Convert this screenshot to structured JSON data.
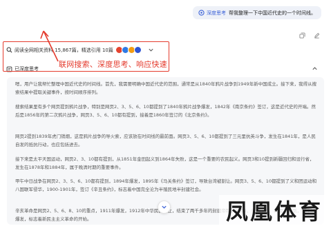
{
  "user_message": {
    "deep_think_label": "深度思考",
    "text": "帮我整理一下中国近代史的一个时间线。"
  },
  "search_summary": {
    "text": "阅读全网相关资料 15,867篇，精选引用 10篇",
    "source_colors": [
      "#e5432f",
      "#2f7ae5",
      "#f39c12",
      "#2f55d4"
    ]
  },
  "thought_summary": {
    "label": "已深度思考"
  },
  "annotation": {
    "text": "联网搜索、深度思考、响应快速",
    "color": "#e43a2c"
  },
  "thinking": {
    "paragraphs": [
      "嗯，用户让我帮忙整理中国近代史的时间线。首先，我需要明确中国近代史的范围，通常是从1840年鸦片战争到1949年新中国成立。接下来，我得从搜索结果中提取关键事件，按时间顺序排列。",
      "搜索结果里有多个网页提到鸦片战争，特别是网页2、3、5、6、10都提到了1840年鸦片战争爆发，1842年《南京条约》签订，这是近代史的开端。然后是1856年的第二次鸦片战争，网页3、5、6、10都有提到，接着是1860年签订的《北京条约》。",
      "网页2提到1839年虎门销烟，这是鸦片战争的导火索，应该放在时间线的最前面。网页3、5、6、10都提到了三元里抗英斗争，发生在1841年，是人民自发的抵抗行动，也应包括进去。",
      "接下来是太平天国运动，网页2、3、10都有提到，从1851年金田起义到1864年失败，这是一个重要的农民起义。网页3和10提到新疆回归和设行省，发生在1878年和1884年，属于晚清时期的重要事件。",
      "甲午中日战争在网页2、3、5、6、10都有提到，1894年爆发，1895年《马关条约》签订，导致台湾被割让。网页3、5、6、10都提到了义和团运动和八国联军侵华，1900-1901年，签订《辛丑条约》，标志着中国完全沦为半殖民地半封建社会。",
      "辛亥革命是网页2、5、6、8、10的重点，1911年爆发，1912年中华民国成立，结束了两千多年的封建帝制。网页2、5、6、8、10都有提到，1919年爆发，标志着新民主主义革命的开始。"
    ]
  },
  "watermark": {
    "text": "凤凰体育"
  }
}
